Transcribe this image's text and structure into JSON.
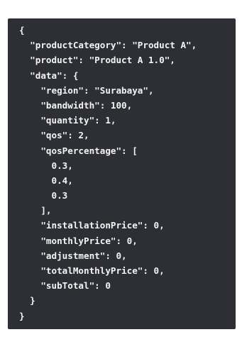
{
  "code": {
    "lines": [
      "{",
      "  \"productCategory\": \"Product A\",",
      "  \"product\": \"Product A 1.0\",",
      "  \"data\": {",
      "    \"region\": \"Surabaya\",",
      "    \"bandwidth\": 100,",
      "    \"quantity\": 1,",
      "    \"qos\": 2,",
      "    \"qosPercentage\": [",
      "      0.3,",
      "      0.4,",
      "      0.3",
      "    ],",
      "    \"installationPrice\": 0,",
      "    \"monthlyPrice\": 0,",
      "    \"adjustment\": 0,",
      "    \"totalMonthlyPrice\": 0,",
      "    \"subTotal\": 0",
      "  }",
      "}"
    ]
  },
  "colors": {
    "panel_background": "#2d2f34",
    "text": "#f4f4f4"
  }
}
